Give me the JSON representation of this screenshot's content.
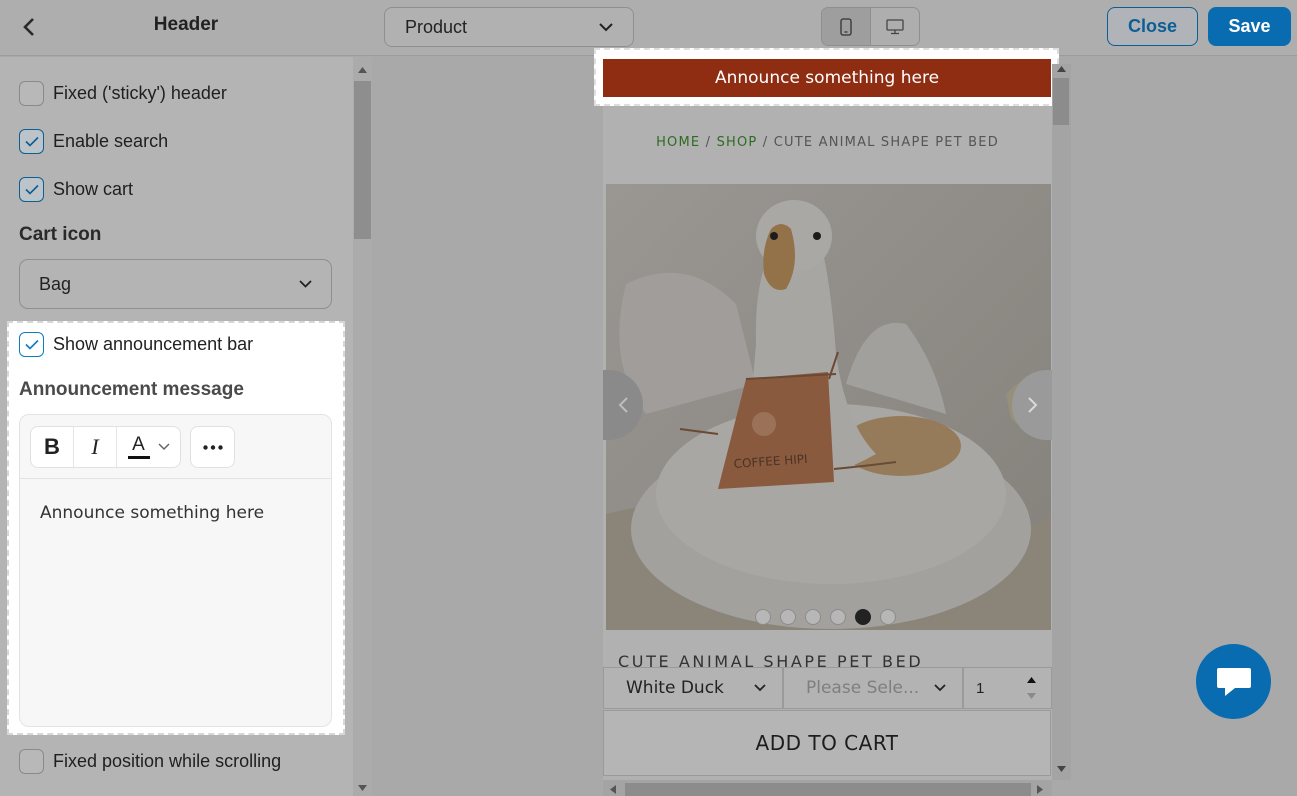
{
  "topbar": {
    "title": "Header",
    "page_select": "Product",
    "close_label": "Close",
    "save_label": "Save"
  },
  "sidebar": {
    "sticky_label": "Fixed ('sticky') header",
    "sticky_checked": false,
    "search_label": "Enable search",
    "search_checked": true,
    "cart_label": "Show cart",
    "cart_checked": true,
    "cart_icon_heading": "Cart icon",
    "cart_icon_value": "Bag",
    "announcement_label": "Show announcement bar",
    "announcement_checked": true,
    "announcement_heading": "Announcement message",
    "announcement_text": "Announce something here",
    "fixed_scroll_label": "Fixed position while scrolling",
    "fixed_scroll_checked": false,
    "toolbar": {
      "bold": "B",
      "italic": "I",
      "color": "A"
    }
  },
  "preview": {
    "announcement": "Announce something here",
    "breadcrumb": {
      "home": "HOME",
      "sep1": " / ",
      "shop": "SHOP",
      "sep2": " / ",
      "current": "CUTE ANIMAL SHAPE PET BED"
    },
    "apron_text": "COFFEE HIPI",
    "product_title": "CUTE ANIMAL SHAPE PET BED",
    "variant_value": "White Duck",
    "variant2_placeholder": "Please Sele...",
    "quantity": "1",
    "add_to_cart": "ADD TO CART",
    "active_slide": 5
  },
  "colors": {
    "accent": "#0a6cb0",
    "announcement_bg": "#8e2d12",
    "breadcrumb_link": "#2f6a23"
  }
}
